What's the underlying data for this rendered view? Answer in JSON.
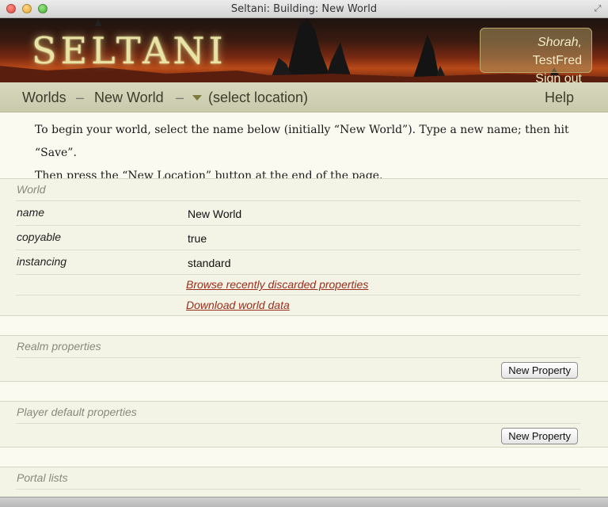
{
  "window": {
    "title": "Seltani: Building: New World"
  },
  "header": {
    "logo": "SELTANI",
    "user_name": "Shorah,",
    "user_id": "TestFred",
    "signout": "Sign out"
  },
  "nav": {
    "worlds": "Worlds",
    "sep": "–",
    "world": "New World",
    "location": "(select location)",
    "help": "Help"
  },
  "intro": {
    "line1": "To begin your world, select the name below (initially “New World”). Type a new name; then hit “Save”.",
    "line2": "Then press the “New Location” button at the end of the page."
  },
  "world_section": {
    "title": "World",
    "rows": [
      {
        "key": "name",
        "value": "New World"
      },
      {
        "key": "copyable",
        "value": "true"
      },
      {
        "key": "instancing",
        "value": "standard"
      }
    ],
    "link_discarded": "Browse recently discarded properties",
    "link_download": "Download world data"
  },
  "realm_section": {
    "title": "Realm properties",
    "button": "New Property"
  },
  "player_section": {
    "title": "Player default properties",
    "button": "New Property"
  },
  "portal_section": {
    "title": "Portal lists"
  },
  "colors": {
    "link": "#9a2e1c",
    "nav_bg": "#d8d8be",
    "content_bg": "#fafaf0"
  }
}
